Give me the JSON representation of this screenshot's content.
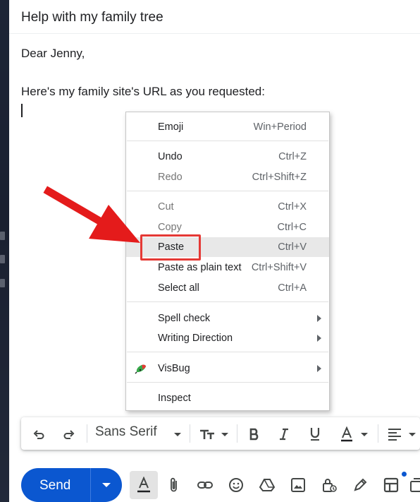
{
  "compose": {
    "subject": "Help with my family tree",
    "greeting": "Dear Jenny,",
    "message_line": "Here's my family site's URL as you requested:"
  },
  "context_menu": {
    "items": [
      {
        "label": "Emoji",
        "shortcut": "Win+Period"
      },
      {
        "label": "Undo",
        "shortcut": "Ctrl+Z"
      },
      {
        "label": "Redo",
        "shortcut": "Ctrl+Shift+Z"
      },
      {
        "label": "Cut",
        "shortcut": "Ctrl+X"
      },
      {
        "label": "Copy",
        "shortcut": "Ctrl+C"
      },
      {
        "label": "Paste",
        "shortcut": "Ctrl+V"
      },
      {
        "label": "Paste as plain text",
        "shortcut": "Ctrl+Shift+V"
      },
      {
        "label": "Select all",
        "shortcut": "Ctrl+A"
      },
      {
        "label": "Spell check"
      },
      {
        "label": "Writing Direction"
      },
      {
        "label": "VisBug"
      },
      {
        "label": "Inspect"
      }
    ],
    "highlighted": "Paste"
  },
  "format_toolbar": {
    "font": "Sans Serif",
    "icons": [
      "undo-icon",
      "redo-icon",
      "font-size-icon",
      "bold-icon",
      "italic-icon",
      "underline-icon",
      "text-color-icon",
      "align-icon"
    ]
  },
  "send": {
    "label": "Send"
  },
  "bottom_icons": [
    "formatting-icon",
    "attach-icon",
    "link-icon",
    "emoji-icon",
    "drive-icon",
    "photo-icon",
    "confidential-icon",
    "signature-icon",
    "layout-icon",
    "more-icon"
  ],
  "colors": {
    "send_blue": "#0b57d0",
    "highlight_red": "#e53935",
    "menu_highlight": "#e8e8e8"
  }
}
